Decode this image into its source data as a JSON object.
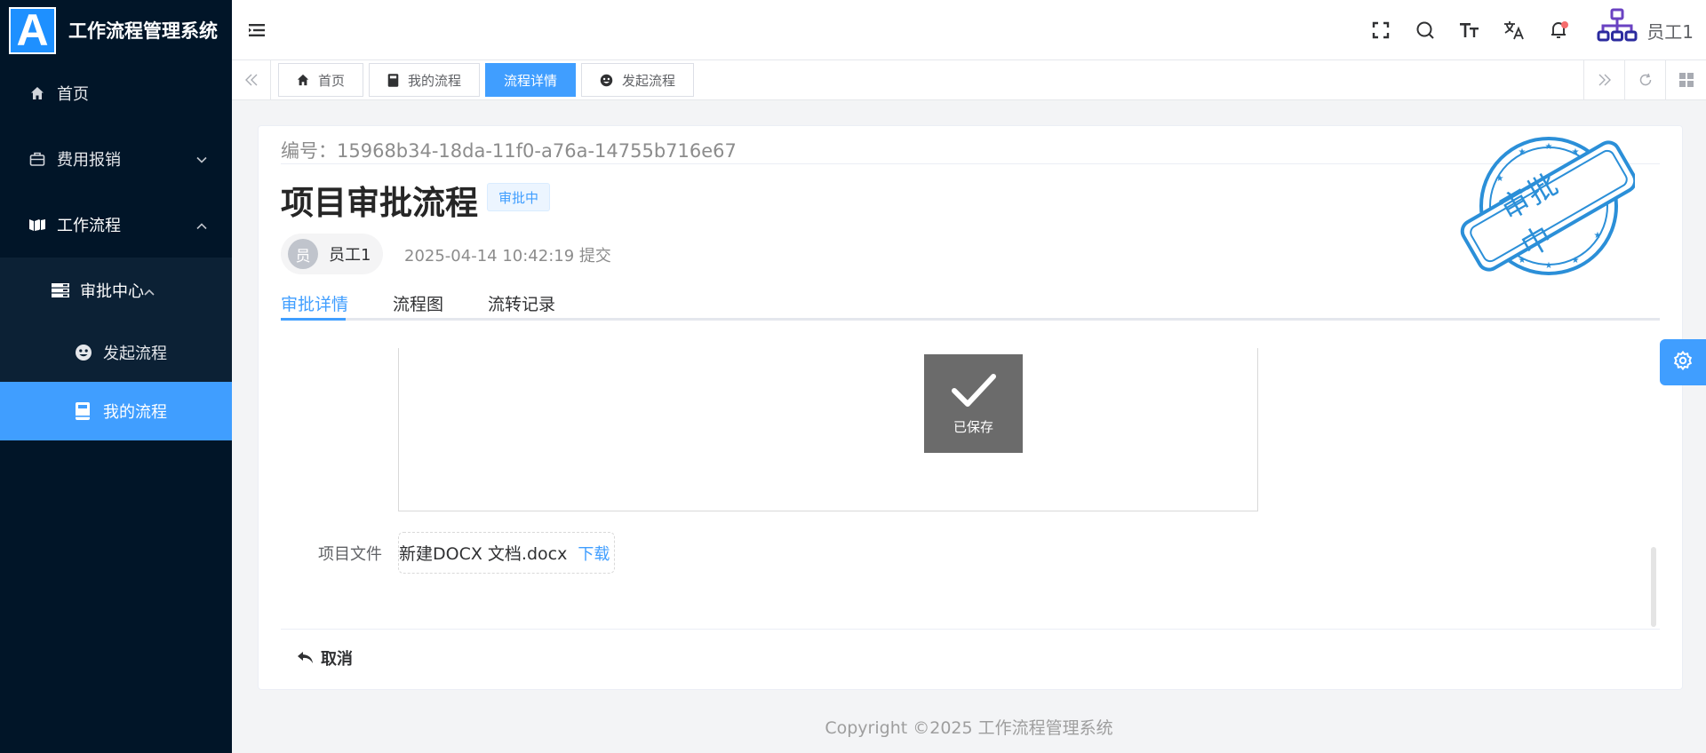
{
  "app": {
    "logo_letter": "A",
    "title": "工作流程管理系统"
  },
  "sidebar": {
    "items": [
      {
        "label": "首页",
        "icon": "home-icon"
      },
      {
        "label": "费用报销",
        "icon": "briefcase-icon"
      },
      {
        "label": "工作流程",
        "icon": "workflow-icon"
      }
    ],
    "sub_group": {
      "label": "审批中心",
      "icon": "server-icon"
    },
    "sub_items": [
      {
        "label": "发起流程",
        "icon": "smile-icon"
      },
      {
        "label": "我的流程",
        "icon": "book-icon"
      }
    ]
  },
  "header": {
    "icons": [
      "fullscreen-icon",
      "search-icon",
      "font-size-icon",
      "translate-icon",
      "bell-icon"
    ],
    "user_name": "员工1"
  },
  "tabs": [
    {
      "label": "首页",
      "icon": "home-icon"
    },
    {
      "label": "我的流程",
      "icon": "book-icon"
    },
    {
      "label": "流程详情",
      "active": true
    },
    {
      "label": "发起流程",
      "icon": "smile-icon"
    }
  ],
  "detail": {
    "serial": "编号：15968b34-18da-11f0-a76a-14755b716e67",
    "title": "项目审批流程",
    "status": "审批中",
    "applicant_avatar": "员",
    "applicant_name": "员工1",
    "submit_time": "2025-04-14 10:42:19 提交",
    "tabs": [
      "审批详情",
      "流程图",
      "流转记录"
    ],
    "saved_toast": "已保存",
    "file_label": "项目文件",
    "file_name": "新建DOCX 文档.docx",
    "download_label": "下载",
    "cancel_label": "取消",
    "stamp_text": "审批中"
  },
  "colors": {
    "primary": "#409eff",
    "sidebar_bg": "#011528",
    "stamp": "#2b8fd8"
  },
  "footer": {
    "copyright": "Copyright ©2025 工作流程管理系统"
  }
}
